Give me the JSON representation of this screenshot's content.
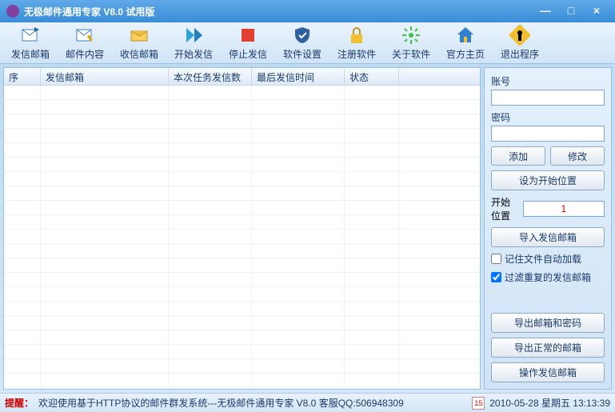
{
  "title": "无极邮件通用专家 V8.0 试用版",
  "toolbar": [
    {
      "label": "发信邮箱",
      "icon": "mail-out"
    },
    {
      "label": "邮件内容",
      "icon": "mail-edit"
    },
    {
      "label": "收信邮箱",
      "icon": "mail-in"
    },
    {
      "label": "开始发信",
      "icon": "play"
    },
    {
      "label": "停止发信",
      "icon": "stop"
    },
    {
      "label": "软件设置",
      "icon": "shield"
    },
    {
      "label": "注册软件",
      "icon": "lock"
    },
    {
      "label": "关于软件",
      "icon": "star"
    },
    {
      "label": "官方主页",
      "icon": "home"
    },
    {
      "label": "退出程序",
      "icon": "exit"
    }
  ],
  "columns": {
    "seq": "序",
    "mailbox": "发信邮箱",
    "task_count": "本次任务发信数",
    "last_time": "最后发信时间",
    "status": "状态"
  },
  "rows": [],
  "side": {
    "account_label": "账号",
    "account_value": "",
    "password_label": "密码",
    "password_value": "",
    "add": "添加",
    "modify": "修改",
    "set_start": "设为开始位置",
    "start_pos_label": "开始位置",
    "start_pos_value": "1",
    "import": "导入发信邮箱",
    "remember": "记住文件自动加载",
    "remember_checked": false,
    "filter": "过滤重复的发信邮箱",
    "filter_checked": true,
    "export_pwd": "导出邮箱和密码",
    "export_ok": "导出正常的邮箱",
    "operate": "操作发信邮箱"
  },
  "status": {
    "tip_label": "提醒：",
    "tip_text": "欢迎使用基于HTTP协议的邮件群发系统---无极邮件通用专家 V8.0 客服QQ:506948309",
    "date": "2010-05-28 星期五 13:13:39",
    "cal": "15"
  }
}
